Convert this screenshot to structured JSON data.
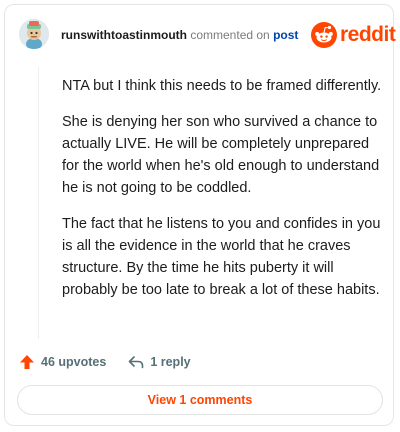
{
  "comment": {
    "username": "runswithtoastinmouth",
    "commented_text": "commented on",
    "post_link": "post",
    "brand": "reddit",
    "paragraphs": [
      "NTA but I think this needs to be framed differently.",
      "She is denying her son who survived a chance to actually LIVE. He will be completely unprepared for the world when he's old enough to understand he is not going to be coddled.",
      "The fact that he listens to you and confides in you is all the evidence in the world that he craves structure. By the time he hits puberty it will probably be too late to break a lot of these habits."
    ]
  },
  "actions": {
    "upvotes": "46 upvotes",
    "reply": "1 reply",
    "view_comments": "View 1 comments"
  },
  "icons": {
    "avatar": "avatar-icon",
    "brand": "reddit-logo-icon",
    "upvote": "upvote-arrow-icon",
    "reply": "reply-arrow-icon"
  },
  "colors": {
    "accent": "#ff4500",
    "link": "#0045ac",
    "muted": "#576f76"
  }
}
